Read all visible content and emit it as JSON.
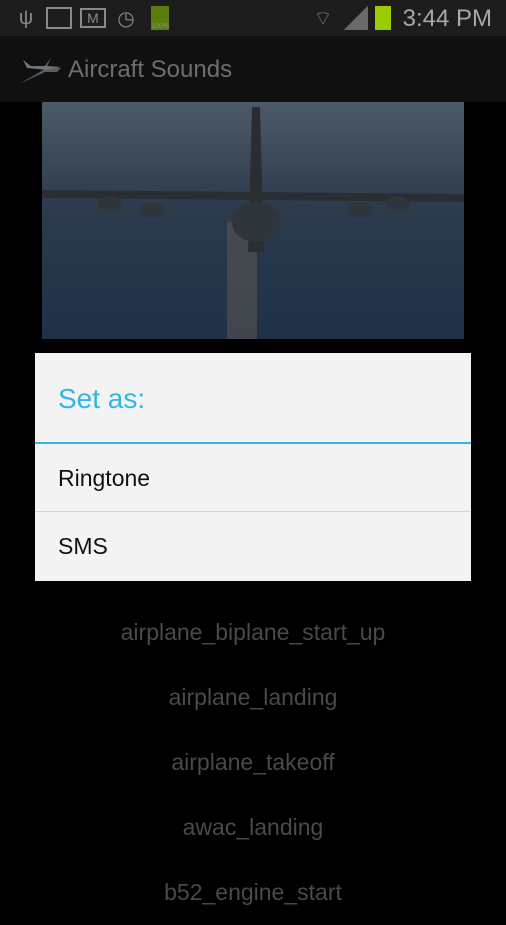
{
  "status_bar": {
    "time": "3:44 PM",
    "battery_label": "100%",
    "icons": [
      "usb-icon",
      "gallery-icon",
      "gmail-icon",
      "clock-icon",
      "battery-icon",
      "wifi-icon",
      "signal-icon",
      "battery-icon"
    ]
  },
  "action_bar": {
    "title": "Aircraft Sounds",
    "icon": "airplane-icon"
  },
  "hero": {
    "image": "aircraft-photo"
  },
  "list": {
    "items": [
      "airplane_biplane_start_up",
      "airplane_landing",
      "airplane_takeoff",
      "awac_landing",
      "b52_engine_start"
    ]
  },
  "dialog": {
    "title": "Set as:",
    "options": [
      "Ringtone",
      "SMS"
    ],
    "accent": "#33b5e5"
  }
}
